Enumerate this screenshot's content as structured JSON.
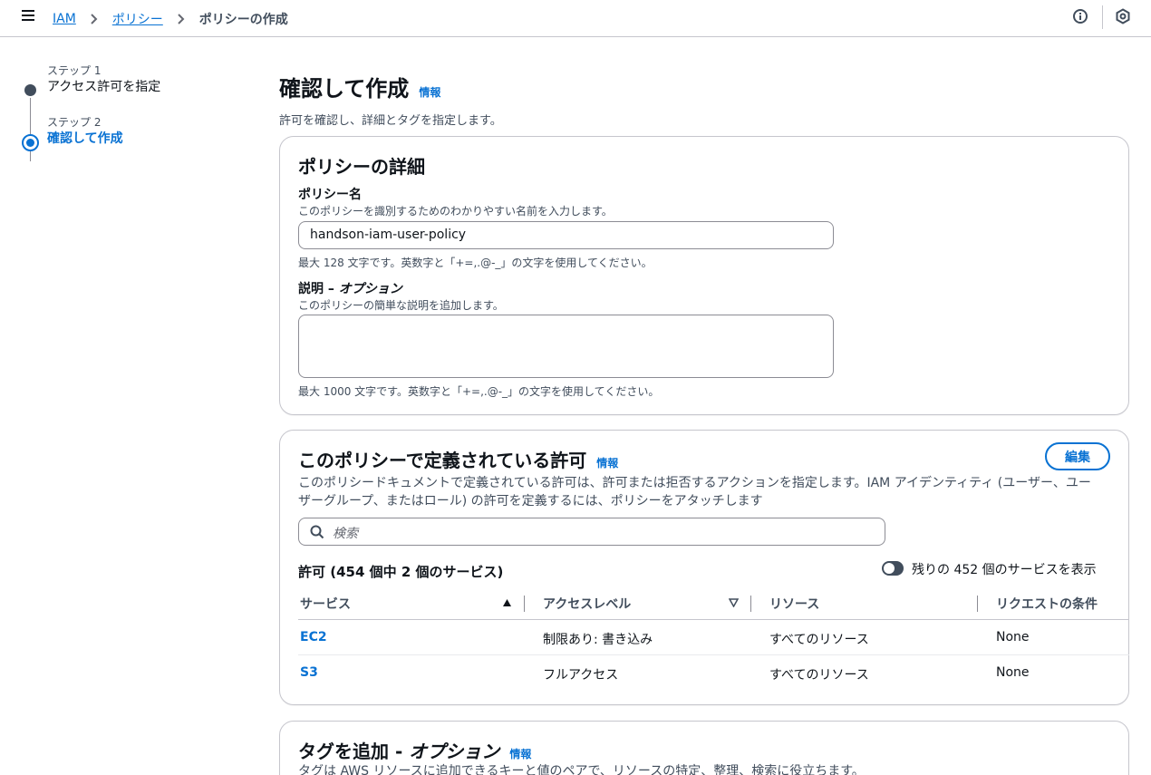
{
  "breadcrumbs": {
    "iam": "IAM",
    "policies": "ポリシー",
    "current": "ポリシーの作成"
  },
  "steps": [
    {
      "caption": "ステップ 1",
      "title": "アクセス許可を指定"
    },
    {
      "caption": "ステップ 2",
      "title": "確認して作成"
    }
  ],
  "page": {
    "title": "確認して作成",
    "info": "情報",
    "description": "許可を確認し、詳細とタグを指定します。"
  },
  "details": {
    "title": "ポリシーの詳細",
    "name_label": "ポリシー名",
    "name_desc": "このポリシーを識別するためのわかりやすい名前を入力します。",
    "name_value": "handson-iam-user-policy",
    "name_constraint": "最大 128 文字です。英数字と「+=,.@-_」の文字を使用してください。",
    "desc_label": "説明 – ",
    "desc_label_optional": "オプション",
    "desc_desc": "このポリシーの簡単な説明を追加します。",
    "desc_value": "",
    "desc_constraint": "最大 1000 文字です。英数字と「+=,.@-_」の文字を使用してください。"
  },
  "permissions": {
    "title": "このポリシーで定義されている許可",
    "info": "情報",
    "edit": "編集",
    "description_line1": "このポリシードキュメントで定義されている許可は、許可または拒否するアクションを指定します。IAM アイデンティティ (ユーザー、ユー",
    "description_line2": "ザーグループ、またはロール) の許可を定義するには、ポリシーをアタッチします",
    "search_placeholder": "検索",
    "table_title": "許可 (454 個中 2 個のサービス)",
    "toggle_label": "残りの 452 個のサービスを表示",
    "toggle_on": false,
    "columns": [
      "サービス",
      "アクセスレベル",
      "リソース",
      "リクエストの条件"
    ],
    "rows": [
      {
        "service": "EC2",
        "access": "制限あり: 書き込み",
        "resource": "すべてのリソース",
        "condition": "None"
      },
      {
        "service": "S3",
        "access": "フルアクセス",
        "resource": "すべてのリソース",
        "condition": "None"
      }
    ]
  },
  "tags": {
    "title": "タグを追加 - ",
    "title_optional": "オプション",
    "info": "情報",
    "description": "タグは AWS リソースに追加できるキーと値のペアで、リソースの特定、整理、検索に役立ちます。"
  },
  "colors": {
    "link": "#0972d3",
    "text": "#0f141a",
    "secondary": "#414d5c",
    "border": "#c6c6cd"
  }
}
